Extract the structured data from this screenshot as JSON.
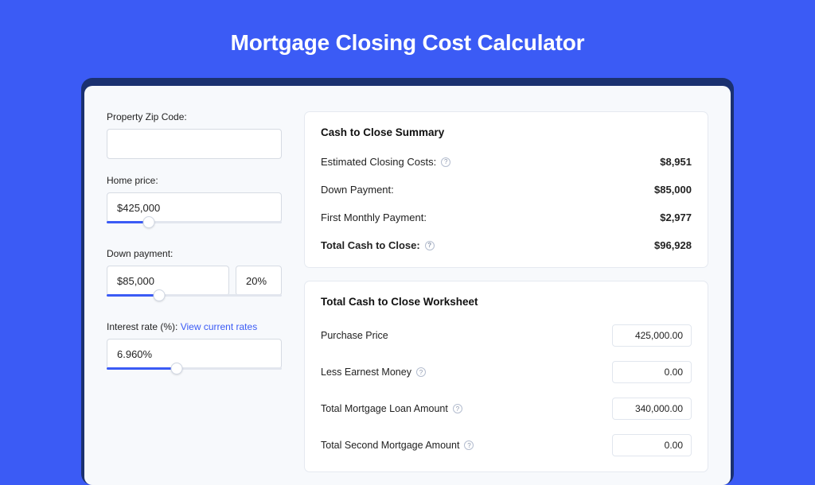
{
  "title": "Mortgage Closing Cost Calculator",
  "form": {
    "zip": {
      "label": "Property Zip Code:",
      "value": ""
    },
    "home_price": {
      "label": "Home price:",
      "value": "$425,000",
      "fill_pct": 24
    },
    "down_payment": {
      "label": "Down payment:",
      "value": "$85,000",
      "pct": "20%",
      "fill_pct": 30
    },
    "interest_rate": {
      "label": "Interest rate (%): ",
      "link": "View current rates",
      "value": "6.960%",
      "fill_pct": 40
    }
  },
  "summary": {
    "title": "Cash to Close Summary",
    "rows": [
      {
        "label": "Estimated Closing Costs:",
        "help": true,
        "value": "$8,951",
        "bold": false
      },
      {
        "label": "Down Payment:",
        "help": false,
        "value": "$85,000",
        "bold": false
      },
      {
        "label": "First Monthly Payment:",
        "help": false,
        "value": "$2,977",
        "bold": false
      },
      {
        "label": "Total Cash to Close:",
        "help": true,
        "value": "$96,928",
        "bold": true
      }
    ]
  },
  "worksheet": {
    "title": "Total Cash to Close Worksheet",
    "rows": [
      {
        "label": "Purchase Price",
        "help": false,
        "value": "425,000.00"
      },
      {
        "label": "Less Earnest Money",
        "help": true,
        "value": "0.00"
      },
      {
        "label": "Total Mortgage Loan Amount",
        "help": true,
        "value": "340,000.00"
      },
      {
        "label": "Total Second Mortgage Amount",
        "help": true,
        "value": "0.00"
      }
    ]
  }
}
